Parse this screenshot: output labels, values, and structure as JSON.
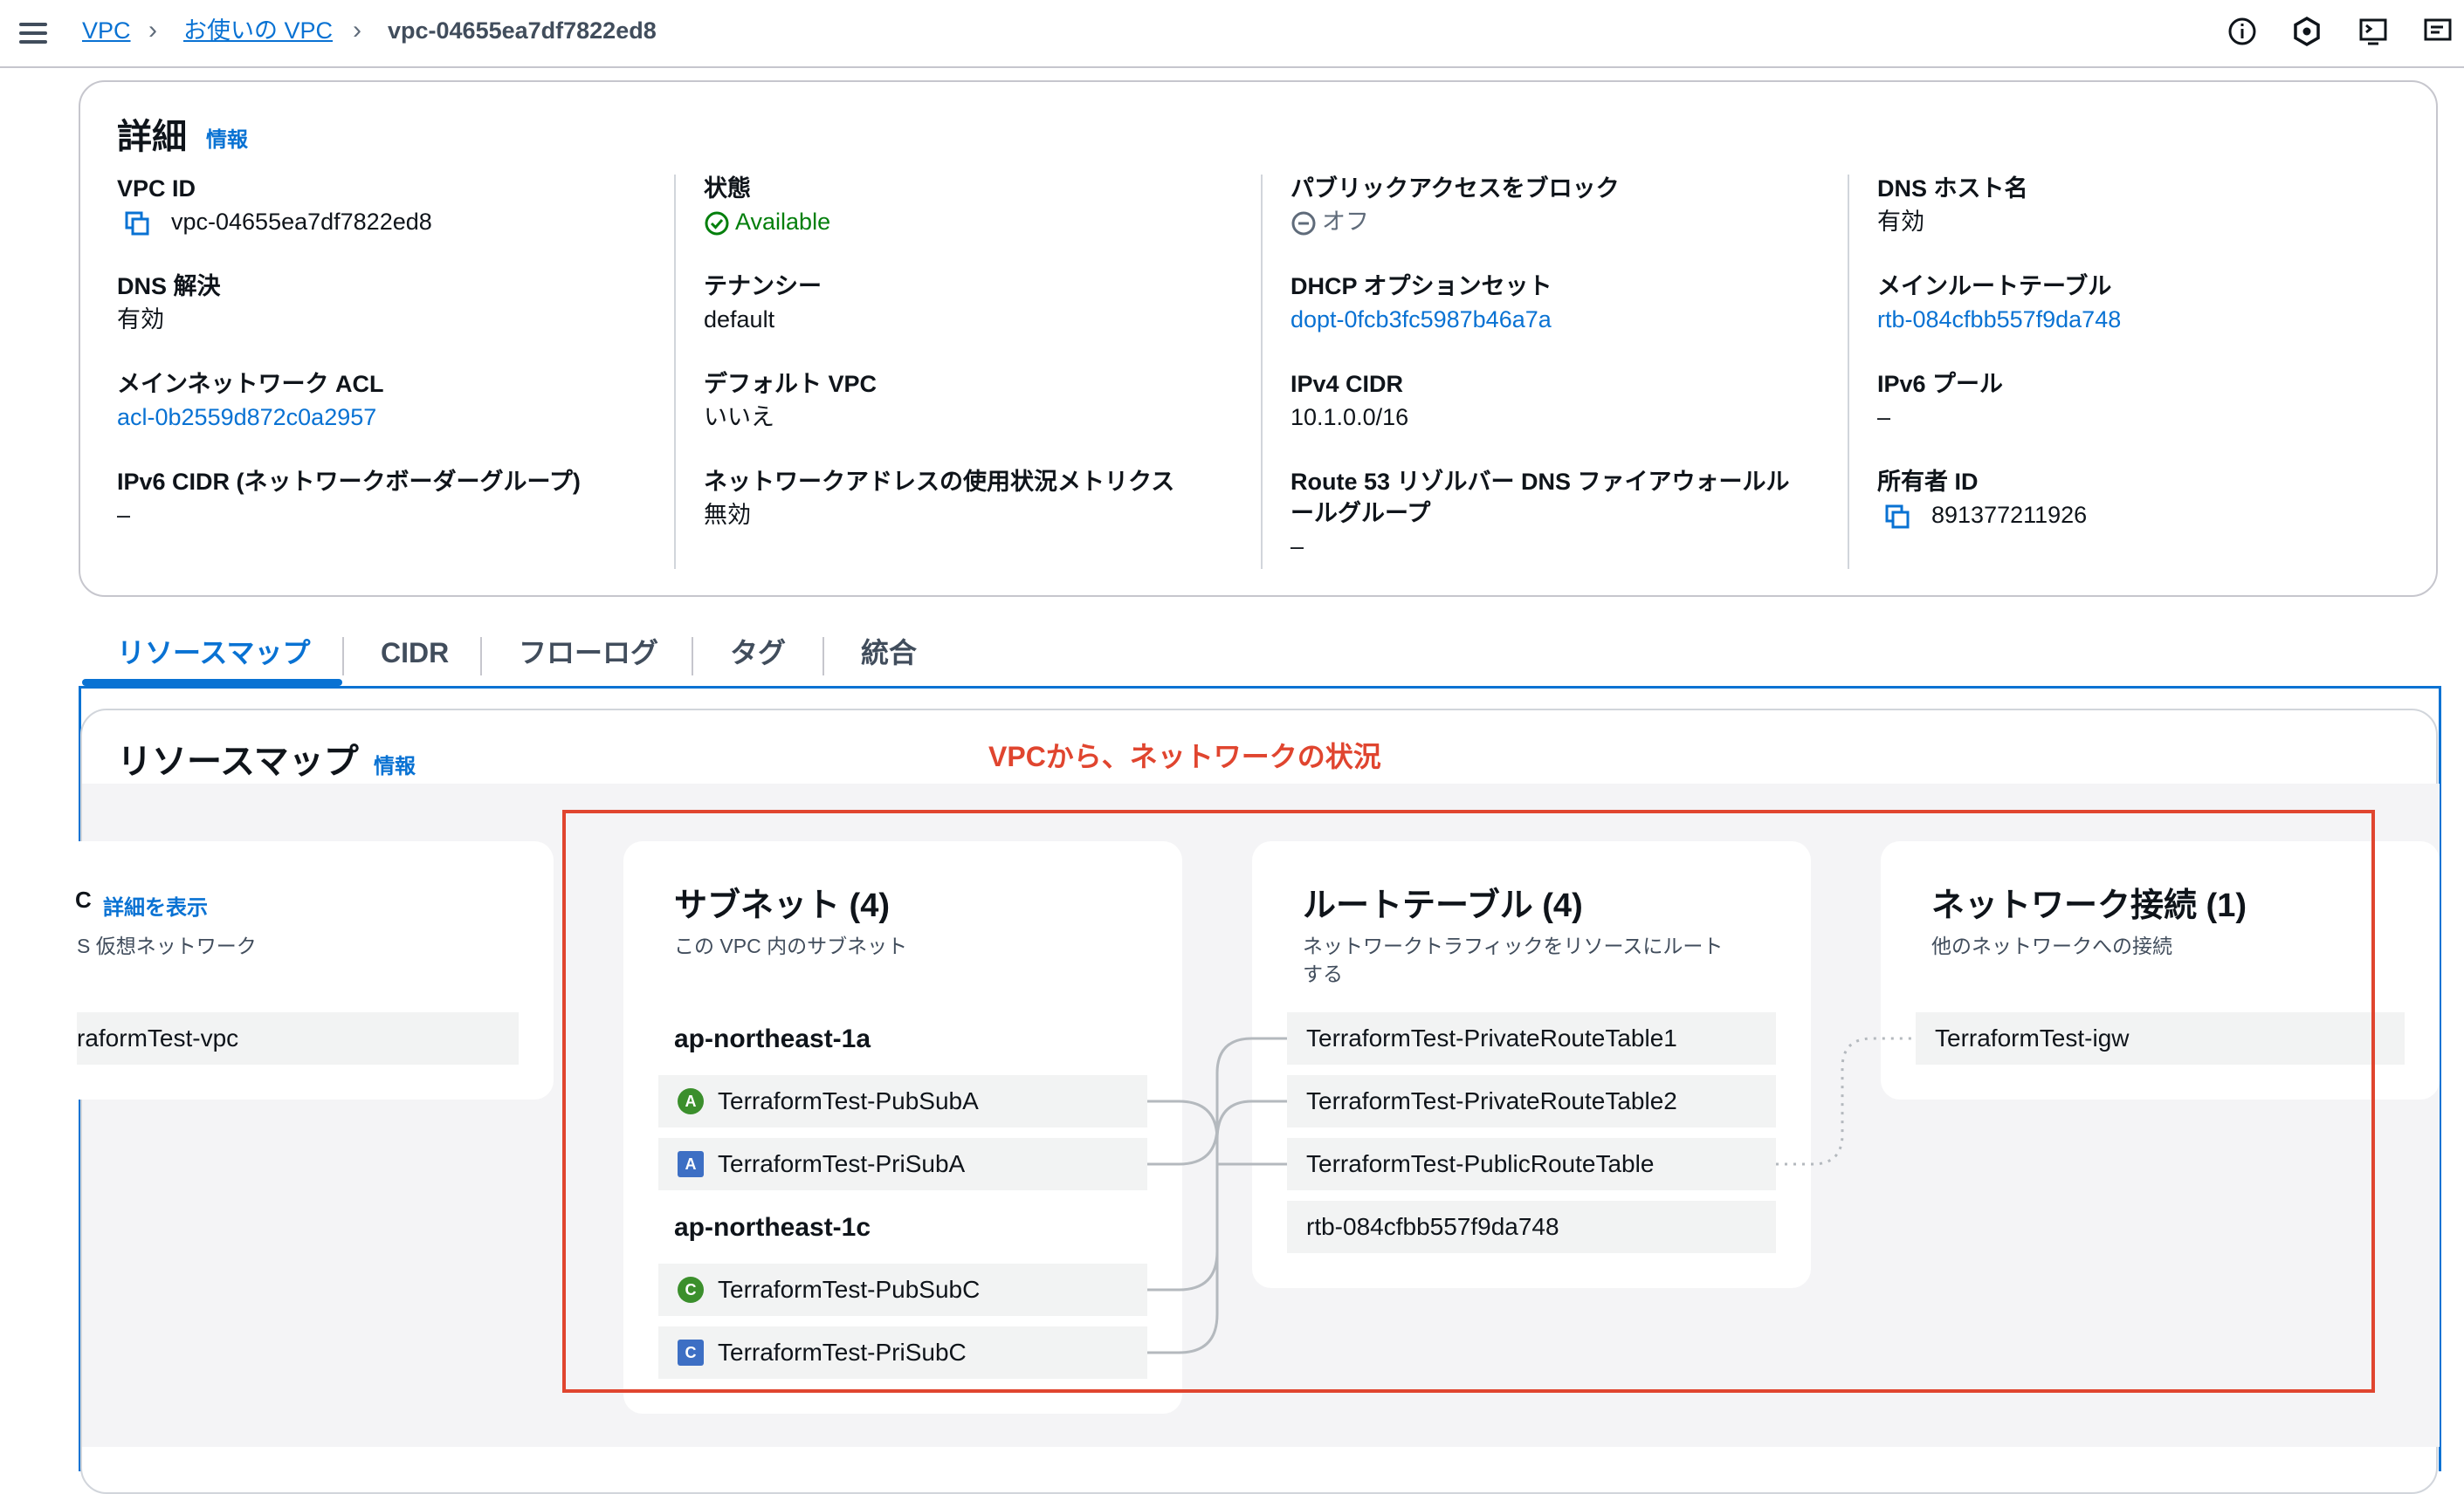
{
  "breadcrumb": {
    "root": "VPC",
    "your_vpcs": "お使いの VPC",
    "current": "vpc-04655ea7df7822ed8"
  },
  "details": {
    "title": "詳細",
    "info": "情報",
    "vpc_id_label": "VPC ID",
    "vpc_id_value": "vpc-04655ea7df7822ed8",
    "state_label": "状態",
    "state_value": "Available",
    "block_public_label": "パブリックアクセスをブロック",
    "block_public_value": "オフ",
    "dns_hostnames_label": "DNS ホスト名",
    "dns_hostnames_value": "有効",
    "dns_resolution_label": "DNS 解決",
    "dns_resolution_value": "有効",
    "tenancy_label": "テナンシー",
    "tenancy_value": "default",
    "dhcp_label": "DHCP オプションセット",
    "dhcp_value": "dopt-0fcb3fc5987b46a7a",
    "main_rtb_label": "メインルートテーブル",
    "main_rtb_value": "rtb-084cfbb557f9da748",
    "main_acl_label": "メインネットワーク ACL",
    "main_acl_value": "acl-0b2559d872c0a2957",
    "default_vpc_label": "デフォルト VPC",
    "default_vpc_value": "いいえ",
    "ipv4_cidr_label": "IPv4 CIDR",
    "ipv4_cidr_value": "10.1.0.0/16",
    "ipv6_pool_label": "IPv6 プール",
    "ipv6_pool_value": "–",
    "ipv6_cidr_label": "IPv6 CIDR (ネットワークボーダーグループ)",
    "ipv6_cidr_value": "–",
    "net_addr_metrics_label": "ネットワークアドレスの使用状況メトリクス",
    "net_addr_metrics_value": "無効",
    "route53_label_1": "Route 53 リゾルバー DNS ファイアウォールル",
    "route53_label_2": "ールグループ",
    "route53_value": "–",
    "owner_label": "所有者 ID",
    "owner_value": "891377211926"
  },
  "tabs": [
    "リソースマップ",
    "CIDR",
    "フローログ",
    "タグ",
    "統合"
  ],
  "resource_map": {
    "title": "リソースマップ",
    "info": "情報",
    "annotation": "VPCから、ネットワークの状況",
    "vpc_card": {
      "title_partial": "C",
      "show_details": "詳細を表示",
      "desc_partial": "S 仮想ネットワーク",
      "item_partial": "raformTest-vpc"
    },
    "subnets": {
      "title": "サブネット (4)",
      "desc": "この VPC 内のサブネット",
      "az1": "ap-northeast-1a",
      "az2": "ap-northeast-1c",
      "items": [
        {
          "badge": "A",
          "kind": "public",
          "name": "TerraformTest-PubSubA"
        },
        {
          "badge": "A",
          "kind": "private",
          "name": "TerraformTest-PriSubA"
        },
        {
          "badge": "C",
          "kind": "public",
          "name": "TerraformTest-PubSubC"
        },
        {
          "badge": "C",
          "kind": "private",
          "name": "TerraformTest-PriSubC"
        }
      ]
    },
    "route_tables": {
      "title": "ルートテーブル (4)",
      "desc_1": "ネットワークトラフィックをリソースにルート",
      "desc_2": "する",
      "items": [
        "TerraformTest-PrivateRouteTable1",
        "TerraformTest-PrivateRouteTable2",
        "TerraformTest-PublicRouteTable",
        "rtb-084cfbb557f9da748"
      ]
    },
    "network_connections": {
      "title": "ネットワーク接続 (1)",
      "desc": "他のネットワークへの接続",
      "items": [
        "TerraformTest-igw"
      ]
    }
  },
  "colors": {
    "link": "#0972d3",
    "available": "#037f0c",
    "annotation": "#e0452f",
    "public_badge": "#3b8f2c",
    "private_badge": "#3d6fc4"
  }
}
